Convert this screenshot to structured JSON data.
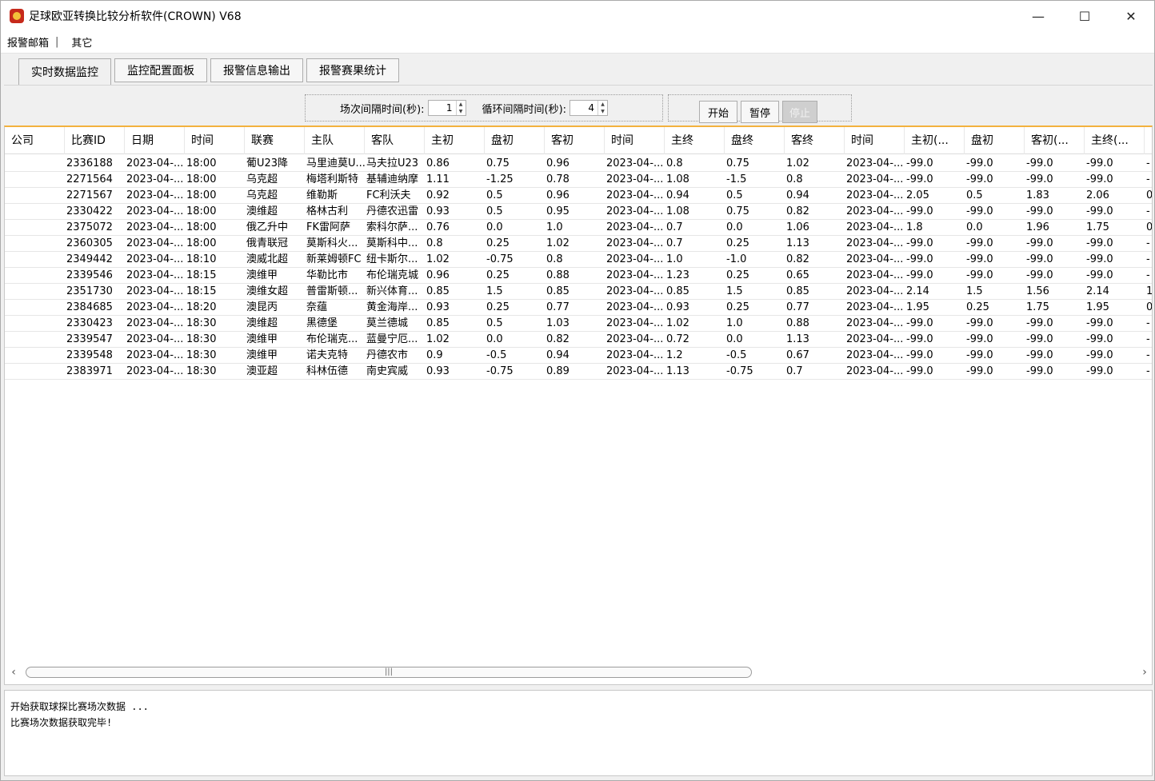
{
  "window": {
    "title": "足球欧亚转换比较分析软件(CROWN) V68",
    "min": "—",
    "max": "☐",
    "close": "✕"
  },
  "menu": [
    "报警邮箱",
    "其它"
  ],
  "menu_sep": "|",
  "tabs": [
    "实时数据监控",
    "监控配置面板",
    "报警信息输出",
    "报警赛果统计"
  ],
  "controls": {
    "match_interval_label": "场次间隔时间(秒):",
    "match_interval": "1",
    "loop_interval_label": "循环间隔时间(秒):",
    "loop_interval": "4",
    "start": "开始",
    "pause": "暂停",
    "stop": "停止"
  },
  "table": {
    "columns": [
      "公司",
      "比赛ID",
      "日期",
      "时间",
      "联赛",
      "主队",
      "客队",
      "主初",
      "盘初",
      "客初",
      "时间",
      "主终",
      "盘终",
      "客终",
      "时间",
      "主初(...",
      "盘初",
      "客初(...",
      "主终(...",
      "..."
    ],
    "rows": [
      [
        "",
        "2336188",
        "2023-04-...",
        "18:00",
        "葡U23降",
        "马里迪莫U...",
        "马夫拉U23",
        "0.86",
        "0.75",
        "0.96",
        "2023-04-...",
        "0.8",
        "0.75",
        "1.02",
        "2023-04-...",
        "-99.0",
        "-99.0",
        "-99.0",
        "-99.0",
        "-"
      ],
      [
        "",
        "2271564",
        "2023-04-...",
        "18:00",
        "乌克超",
        "梅塔利斯特",
        "基辅迪纳摩",
        "1.11",
        "-1.25",
        "0.78",
        "2023-04-...",
        "1.08",
        "-1.5",
        "0.8",
        "2023-04-...",
        "-99.0",
        "-99.0",
        "-99.0",
        "-99.0",
        "-"
      ],
      [
        "",
        "2271567",
        "2023-04-...",
        "18:00",
        "乌克超",
        "维勒斯",
        "FC利沃夫",
        "0.92",
        "0.5",
        "0.96",
        "2023-04-...",
        "0.94",
        "0.5",
        "0.94",
        "2023-04-...",
        "2.05",
        "0.5",
        "1.83",
        "2.06",
        "0"
      ],
      [
        "",
        "2330422",
        "2023-04-...",
        "18:00",
        "澳维超",
        "格林古利",
        "丹德农迅雷",
        "0.93",
        "0.5",
        "0.95",
        "2023-04-...",
        "1.08",
        "0.75",
        "0.82",
        "2023-04-...",
        "-99.0",
        "-99.0",
        "-99.0",
        "-99.0",
        "-"
      ],
      [
        "",
        "2375072",
        "2023-04-...",
        "18:00",
        "俄乙升中",
        "FK雷阿萨",
        "索科尔萨...",
        "0.76",
        "0.0",
        "1.0",
        "2023-04-...",
        "0.7",
        "0.0",
        "1.06",
        "2023-04-...",
        "1.8",
        "0.0",
        "1.96",
        "1.75",
        "0"
      ],
      [
        "",
        "2360305",
        "2023-04-...",
        "18:00",
        "俄青联冠",
        "莫斯科火...",
        "莫斯科中...",
        "0.8",
        "0.25",
        "1.02",
        "2023-04-...",
        "0.7",
        "0.25",
        "1.13",
        "2023-04-...",
        "-99.0",
        "-99.0",
        "-99.0",
        "-99.0",
        "-"
      ],
      [
        "",
        "2349442",
        "2023-04-...",
        "18:10",
        "澳威北超",
        "新莱姆顿FC",
        "纽卡斯尔...",
        "1.02",
        "-0.75",
        "0.8",
        "2023-04-...",
        "1.0",
        "-1.0",
        "0.82",
        "2023-04-...",
        "-99.0",
        "-99.0",
        "-99.0",
        "-99.0",
        "-"
      ],
      [
        "",
        "2339546",
        "2023-04-...",
        "18:15",
        "澳维甲",
        "华勒比市",
        "布伦瑞克城",
        "0.96",
        "0.25",
        "0.88",
        "2023-04-...",
        "1.23",
        "0.25",
        "0.65",
        "2023-04-...",
        "-99.0",
        "-99.0",
        "-99.0",
        "-99.0",
        "-"
      ],
      [
        "",
        "2351730",
        "2023-04-...",
        "18:15",
        "澳维女超",
        "普雷斯顿...",
        "新兴体育...",
        "0.85",
        "1.5",
        "0.85",
        "2023-04-...",
        "0.85",
        "1.5",
        "0.85",
        "2023-04-...",
        "2.14",
        "1.5",
        "1.56",
        "2.14",
        "1"
      ],
      [
        "",
        "2384685",
        "2023-04-...",
        "18:20",
        "澳昆丙",
        "奈蕴",
        "黄金海岸...",
        "0.93",
        "0.25",
        "0.77",
        "2023-04-...",
        "0.93",
        "0.25",
        "0.77",
        "2023-04-...",
        "1.95",
        "0.25",
        "1.75",
        "1.95",
        "0"
      ],
      [
        "",
        "2330423",
        "2023-04-...",
        "18:30",
        "澳维超",
        "黑德堡",
        "莫兰德城",
        "0.85",
        "0.5",
        "1.03",
        "2023-04-...",
        "1.02",
        "1.0",
        "0.88",
        "2023-04-...",
        "-99.0",
        "-99.0",
        "-99.0",
        "-99.0",
        "-"
      ],
      [
        "",
        "2339547",
        "2023-04-...",
        "18:30",
        "澳维甲",
        "布伦瑞克...",
        "蓝曼宁厄...",
        "1.02",
        "0.0",
        "0.82",
        "2023-04-...",
        "0.72",
        "0.0",
        "1.13",
        "2023-04-...",
        "-99.0",
        "-99.0",
        "-99.0",
        "-99.0",
        "-"
      ],
      [
        "",
        "2339548",
        "2023-04-...",
        "18:30",
        "澳维甲",
        "诺夫克特",
        "丹德农市",
        "0.9",
        "-0.5",
        "0.94",
        "2023-04-...",
        "1.2",
        "-0.5",
        "0.67",
        "2023-04-...",
        "-99.0",
        "-99.0",
        "-99.0",
        "-99.0",
        "-"
      ],
      [
        "",
        "2383971",
        "2023-04-...",
        "18:30",
        "澳亚超",
        "科林伍德",
        "南史宾威",
        "0.93",
        "-0.75",
        "0.89",
        "2023-04-...",
        "1.13",
        "-0.75",
        "0.7",
        "2023-04-...",
        "-99.0",
        "-99.0",
        "-99.0",
        "-99.0",
        "-"
      ]
    ]
  },
  "scroll": {
    "left": "‹",
    "right": "›",
    "grip": "|||"
  },
  "log": [
    "开始获取球探比赛场次数据 ...",
    "比赛场次数据获取完毕!"
  ]
}
